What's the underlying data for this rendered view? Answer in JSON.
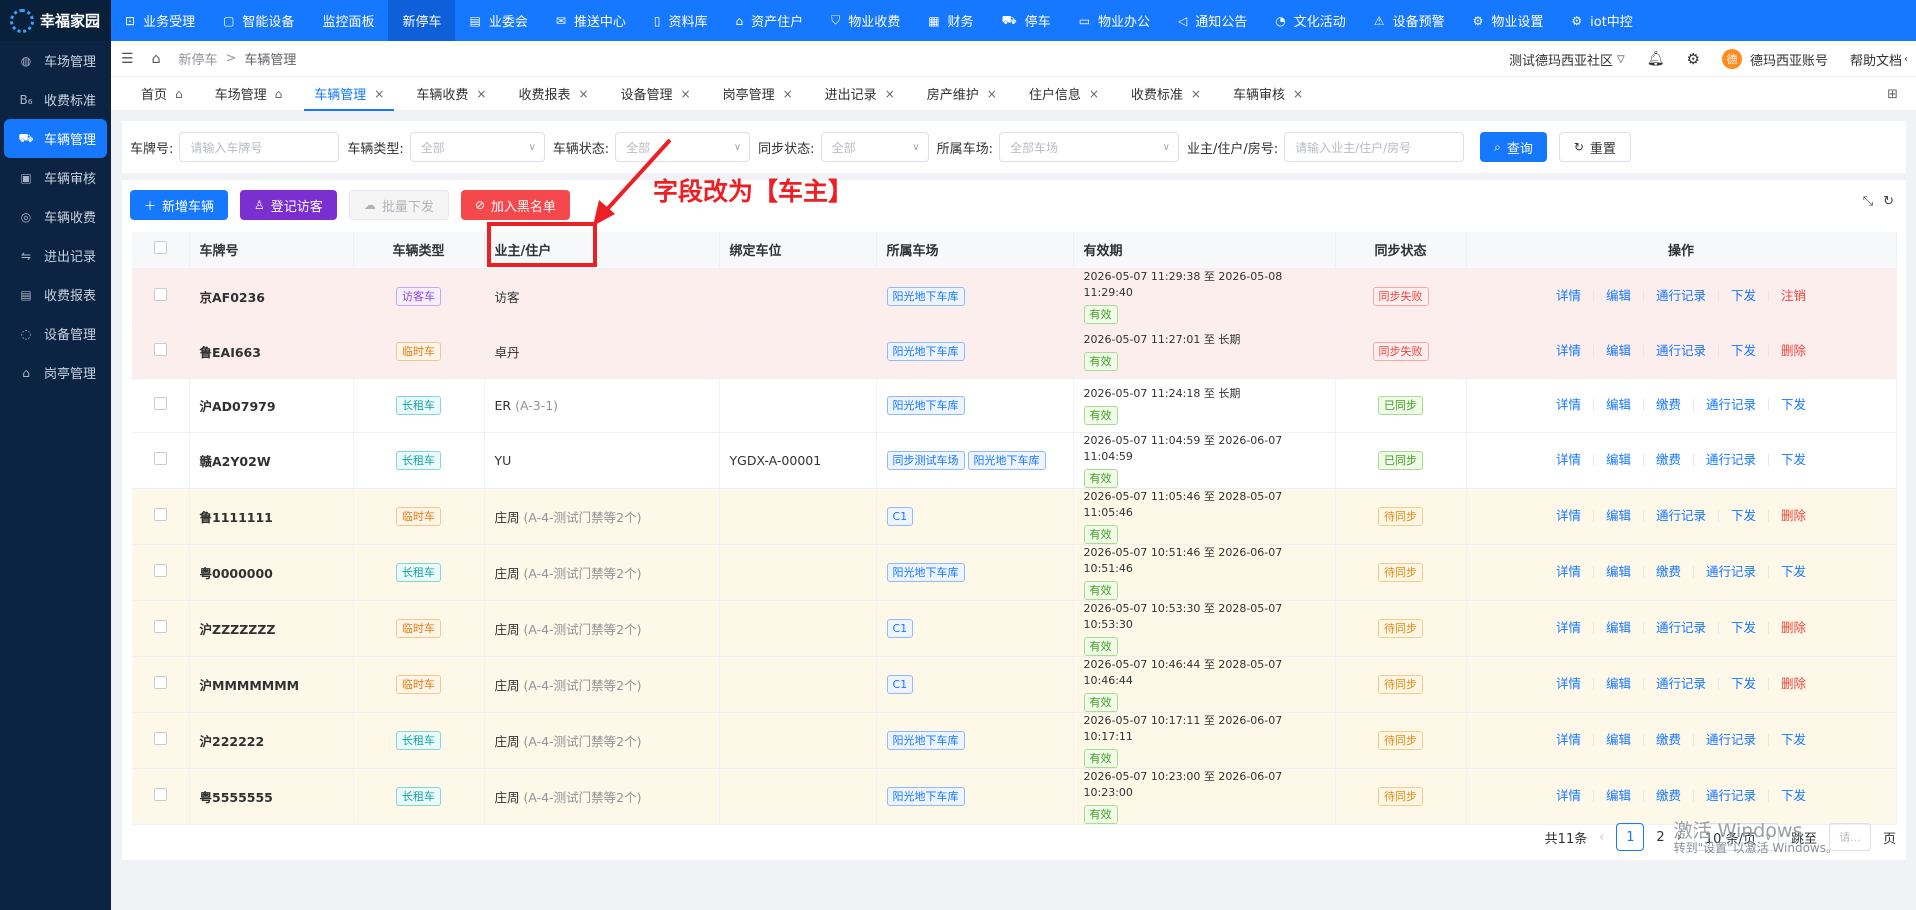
{
  "app": {
    "name": "幸福家园"
  },
  "sidebar": {
    "items": [
      {
        "label": "车场管理",
        "icon": "parking-lot-icon",
        "glyph": "◍"
      },
      {
        "label": "收费标准",
        "icon": "fee-standard-icon",
        "glyph": "B₆"
      },
      {
        "label": "车辆管理",
        "icon": "car-icon",
        "glyph": "⛟",
        "active": true
      },
      {
        "label": "车辆审核",
        "icon": "audit-icon",
        "glyph": "▣"
      },
      {
        "label": "车辆收费",
        "icon": "coin-icon",
        "glyph": "◎"
      },
      {
        "label": "进出记录",
        "icon": "record-icon",
        "glyph": "⇋"
      },
      {
        "label": "收费报表",
        "icon": "report-icon",
        "glyph": "▤"
      },
      {
        "label": "设备管理",
        "icon": "device-icon",
        "glyph": "◌"
      },
      {
        "label": "岗亭管理",
        "icon": "booth-icon",
        "glyph": "⌂"
      }
    ]
  },
  "topnav": {
    "items": [
      {
        "label": "业务受理",
        "icon": "desk-icon",
        "glyph": "⊡"
      },
      {
        "label": "智能设备",
        "icon": "device-icon",
        "glyph": "▢"
      },
      {
        "label": "监控面板",
        "icon": "",
        "glyph": ""
      },
      {
        "label": "新停车",
        "icon": "",
        "glyph": "",
        "active": true
      },
      {
        "label": "业委会",
        "icon": "committee-icon",
        "glyph": "▤"
      },
      {
        "label": "推送中心",
        "icon": "push-icon",
        "glyph": "✉"
      },
      {
        "label": "资料库",
        "icon": "document-icon",
        "glyph": "▯"
      },
      {
        "label": "资产住户",
        "icon": "home-icon",
        "glyph": "⌂"
      },
      {
        "label": "物业收费",
        "icon": "shield-icon",
        "glyph": "⛉"
      },
      {
        "label": "财务",
        "icon": "finance-icon",
        "glyph": "▦"
      },
      {
        "label": "停车",
        "icon": "car-icon",
        "glyph": "⛟"
      },
      {
        "label": "物业办公",
        "icon": "monitor-icon",
        "glyph": "▭"
      },
      {
        "label": "通知公告",
        "icon": "megaphone-icon",
        "glyph": "◁"
      },
      {
        "label": "文化活动",
        "icon": "activity-icon",
        "glyph": "◔"
      },
      {
        "label": "设备预警",
        "icon": "warning-icon",
        "glyph": "⚠"
      },
      {
        "label": "物业设置",
        "icon": "gear-icon",
        "glyph": "⚙"
      },
      {
        "label": "iot中控",
        "icon": "iot-icon",
        "glyph": "⚙"
      }
    ]
  },
  "header": {
    "breadcrumb": [
      "新停车",
      "车辆管理"
    ],
    "community": "测试德玛西亚社区",
    "account": "德玛西亚账号",
    "avatar_text": "德",
    "help": "帮助文档"
  },
  "tabs": [
    {
      "label": "首页",
      "closable": false,
      "home": true
    },
    {
      "label": "车场管理",
      "closable": false,
      "home": true
    },
    {
      "label": "车辆管理",
      "closable": true,
      "active": true
    },
    {
      "label": "车辆收费",
      "closable": true
    },
    {
      "label": "收费报表",
      "closable": true
    },
    {
      "label": "设备管理",
      "closable": true
    },
    {
      "label": "岗亭管理",
      "closable": true
    },
    {
      "label": "进出记录",
      "closable": true
    },
    {
      "label": "房产维护",
      "closable": true
    },
    {
      "label": "住户信息",
      "closable": true
    },
    {
      "label": "收费标准",
      "closable": true
    },
    {
      "label": "车辆审核",
      "closable": true
    }
  ],
  "filter": {
    "plate_label": "车牌号:",
    "plate_placeholder": "请输入车牌号",
    "type_label": "车辆类型:",
    "type_value": "全部",
    "status_label": "车辆状态:",
    "status_value": "全部",
    "sync_label": "同步状态:",
    "sync_value": "全部",
    "lot_label": "所属车场:",
    "lot_value": "全部车场",
    "owner_label": "业主/住户/房号:",
    "owner_placeholder": "请输入业主/住户/房号",
    "search_button": "查询",
    "reset_button": "重置"
  },
  "toolbar": {
    "add": "新增车辆",
    "visitor": "登记访客",
    "batch": "批量下发",
    "blacklist": "加入黑名单"
  },
  "table": {
    "columns": [
      "车牌号",
      "车辆类型",
      "业主/住户",
      "绑定车位",
      "所属车场",
      "有效期",
      "同步状态",
      "操作"
    ],
    "valid_tag": "有效",
    "rows": [
      {
        "bg": "red",
        "plate": "京AF0236",
        "type": "访客车",
        "type_class": "t-visitor",
        "owner": "访客",
        "room": "",
        "space": "",
        "lots": [
          "阳光地下车库"
        ],
        "period": "2026-05-07 11:29:38 至 2026-05-08 11:29:40",
        "sync": "同步失败",
        "sync_class": "t-fail",
        "ops": [
          "详情",
          "编辑",
          "通行记录",
          "下发",
          "注销"
        ]
      },
      {
        "bg": "red",
        "plate": "鲁EAI663",
        "type": "临时车",
        "type_class": "t-temp",
        "owner": "卓丹",
        "room": "",
        "space": "",
        "lots": [
          "阳光地下车库"
        ],
        "period": "2026-05-07 11:27:01 至 长期",
        "sync": "同步失败",
        "sync_class": "t-fail",
        "ops": [
          "详情",
          "编辑",
          "通行记录",
          "下发",
          "删除"
        ]
      },
      {
        "bg": "",
        "plate": "沪AD07979",
        "type": "长租车",
        "type_class": "t-long",
        "owner": "ER",
        "room": "(A-3-1)",
        "space": "",
        "lots": [
          "阳光地下车库"
        ],
        "period": "2026-05-07 11:24:18 至 长期",
        "sync": "已同步",
        "sync_class": "t-ok",
        "ops": [
          "详情",
          "编辑",
          "缴费",
          "通行记录",
          "下发"
        ]
      },
      {
        "bg": "",
        "plate": "赣A2Y02W",
        "type": "长租车",
        "type_class": "t-long",
        "owner": "YU",
        "room": "",
        "space": "YGDX-A-00001",
        "lots": [
          "同步测试车场",
          "阳光地下车库"
        ],
        "period": "2026-05-07 11:04:59 至 2026-06-07 11:04:59",
        "sync": "已同步",
        "sync_class": "t-ok",
        "ops": [
          "详情",
          "编辑",
          "缴费",
          "通行记录",
          "下发"
        ]
      },
      {
        "bg": "yellow",
        "plate": "鲁1111111",
        "type": "临时车",
        "type_class": "t-temp",
        "owner": "庄周",
        "room": "(A-4-测试门禁等2个)",
        "space": "",
        "lots": [
          "C1"
        ],
        "period": "2026-05-07 11:05:46 至 2028-05-07 11:05:46",
        "sync": "待同步",
        "sync_class": "t-wait",
        "ops": [
          "详情",
          "编辑",
          "通行记录",
          "下发",
          "删除"
        ]
      },
      {
        "bg": "yellow",
        "plate": "粤0000000",
        "type": "长租车",
        "type_class": "t-long",
        "owner": "庄周",
        "room": "(A-4-测试门禁等2个)",
        "space": "",
        "lots": [
          "阳光地下车库"
        ],
        "period": "2026-05-07 10:51:46 至 2026-06-07 10:51:46",
        "sync": "待同步",
        "sync_class": "t-wait",
        "ops": [
          "详情",
          "编辑",
          "缴费",
          "通行记录",
          "下发"
        ]
      },
      {
        "bg": "yellow",
        "plate": "沪ZZZZZZZ",
        "type": "临时车",
        "type_class": "t-temp",
        "owner": "庄周",
        "room": "(A-4-测试门禁等2个)",
        "space": "",
        "lots": [
          "C1"
        ],
        "period": "2026-05-07 10:53:30 至 2028-05-07 10:53:30",
        "sync": "待同步",
        "sync_class": "t-wait",
        "ops": [
          "详情",
          "编辑",
          "通行记录",
          "下发",
          "删除"
        ]
      },
      {
        "bg": "yellow",
        "plate": "沪MMMMMMM",
        "type": "临时车",
        "type_class": "t-temp",
        "owner": "庄周",
        "room": "(A-4-测试门禁等2个)",
        "space": "",
        "lots": [
          "C1"
        ],
        "period": "2026-05-07 10:46:44 至 2028-05-07 10:46:44",
        "sync": "待同步",
        "sync_class": "t-wait",
        "ops": [
          "详情",
          "编辑",
          "通行记录",
          "下发",
          "删除"
        ]
      },
      {
        "bg": "yellow",
        "plate": "沪222222",
        "type": "长租车",
        "type_class": "t-long",
        "owner": "庄周",
        "room": "(A-4-测试门禁等2个)",
        "space": "",
        "lots": [
          "阳光地下车库"
        ],
        "period": "2026-05-07 10:17:11 至 2026-06-07 10:17:11",
        "sync": "待同步",
        "sync_class": "t-wait",
        "ops": [
          "详情",
          "编辑",
          "缴费",
          "通行记录",
          "下发"
        ]
      },
      {
        "bg": "yellow",
        "plate": "粤5555555",
        "type": "长租车",
        "type_class": "t-long",
        "owner": "庄周",
        "room": "(A-4-测试门禁等2个)",
        "space": "",
        "lots": [
          "阳光地下车库"
        ],
        "period": "2026-05-07 10:23:00 至 2026-06-07 10:23:00",
        "sync": "待同步",
        "sync_class": "t-wait",
        "ops": [
          "详情",
          "编辑",
          "缴费",
          "通行记录",
          "下发"
        ]
      }
    ]
  },
  "annotation": {
    "text": "字段改为【车主】"
  },
  "pagination": {
    "total": "共11条",
    "current": "1",
    "next_page": "2",
    "page_size": "10 条/页",
    "jump_label": "跳至",
    "jump_placeholder": "请...",
    "page_suffix": "页"
  },
  "windows_notice": {
    "title": "激活 Windows",
    "subtitle": "转到\"设置\"以激活 Windows。"
  }
}
